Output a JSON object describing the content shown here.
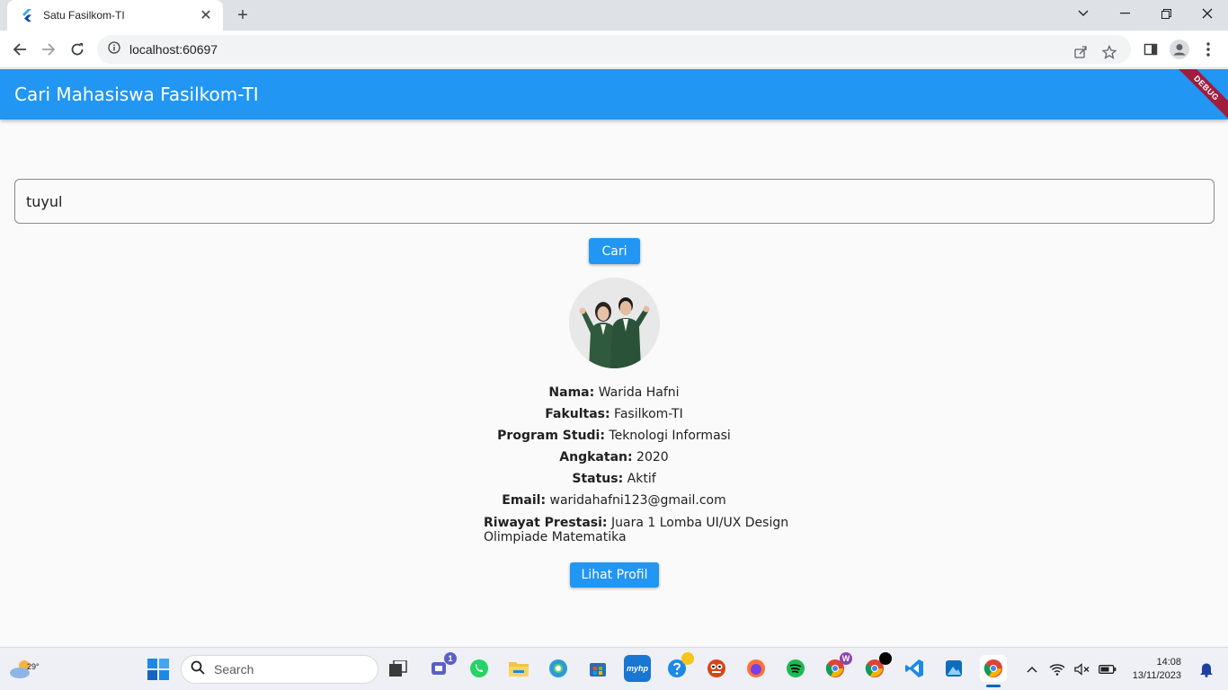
{
  "browser": {
    "tab_title": "Satu Fasilkom-TI",
    "url": "localhost:60697"
  },
  "app": {
    "title": "Cari Mahasiswa Fasilkom-TI",
    "debug_banner": "DEBUG",
    "search_value": "tuyul",
    "search_button": "Cari",
    "profile_button": "Lihat Profil",
    "accent_color": "#2196f3"
  },
  "student": {
    "fields": [
      {
        "label": "Nama:",
        "value": "Warida Hafni"
      },
      {
        "label": "Fakultas:",
        "value": "Fasilkom-TI"
      },
      {
        "label": "Program Studi:",
        "value": "Teknologi Informasi"
      },
      {
        "label": "Angkatan:",
        "value": "2020"
      },
      {
        "label": "Status:",
        "value": "Aktif"
      },
      {
        "label": "Email:",
        "value": "waridahafni123@gmail.com"
      }
    ],
    "prestasi_label": "Riwayat Prestasi:",
    "prestasi": [
      "Juara 1 Lomba UI/UX Design",
      "Olimpiade Matematika"
    ]
  },
  "taskbar": {
    "weather_temp": "29°",
    "search_placeholder": "Search",
    "teams_badge": "1",
    "time": "14:08",
    "date": "13/11/2023"
  }
}
